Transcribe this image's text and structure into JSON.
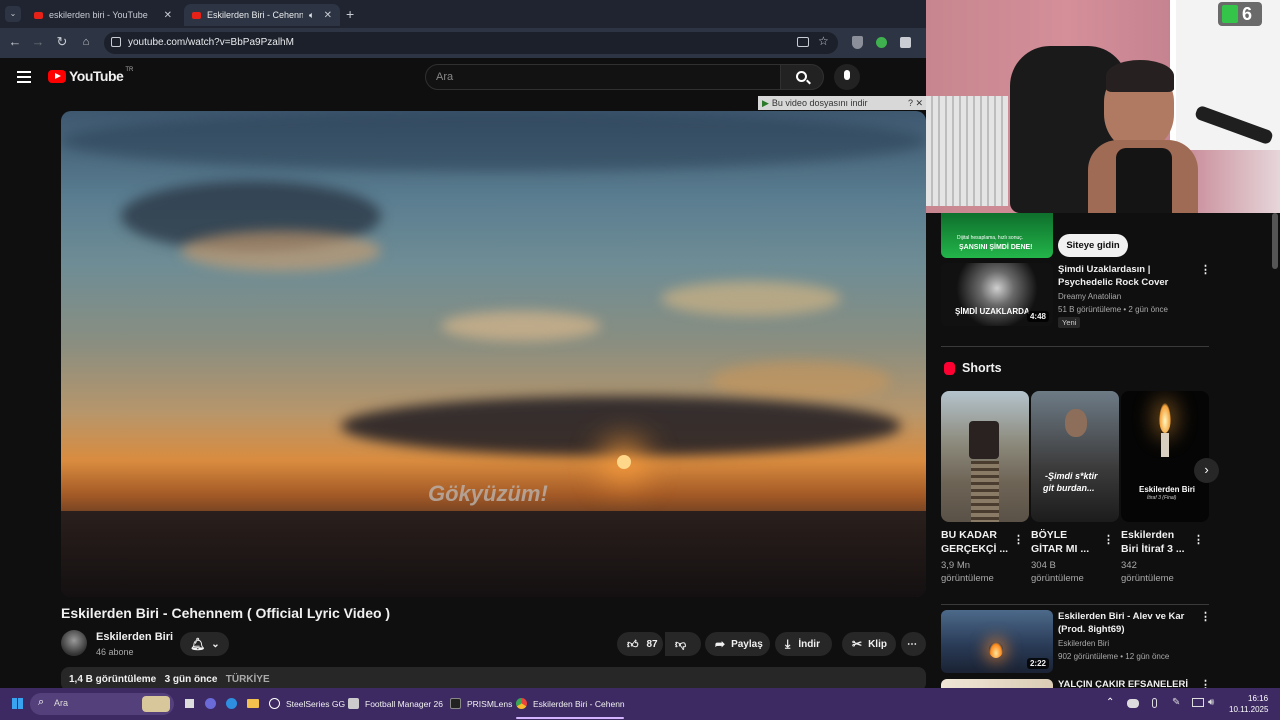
{
  "browser": {
    "tabs": [
      {
        "label": "eskilerden biri - YouTube"
      },
      {
        "label": "Eskilerden Biri - Cehennem"
      }
    ],
    "url": "youtube.com/watch?v=BbPa9PzalhM",
    "download_bar": "Bu video dosyasını indir"
  },
  "header": {
    "logo": "YouTube",
    "region": "TR",
    "search_placeholder": "Ara"
  },
  "video": {
    "lyric": "Gökyüzüm!",
    "title": "Eskilerden Biri - Cehennem ( Official Lyric Video )",
    "channel": "Eskilerden Biri",
    "subscribers": "46 abone",
    "likes": "87",
    "share": "Paylaş",
    "download": "İndir",
    "clip": "Klip",
    "views": "1,4 B görüntüleme",
    "age": "3 gün önce",
    "location": "TÜRKİYE"
  },
  "webcam": {
    "badge": "6"
  },
  "sidebar": {
    "ad": {
      "line1": "Dijital hesaplama, hızlı sonuç.",
      "line2": "ŞANSINI ŞİMDİ DENE!",
      "button": "Siteye gidin"
    },
    "rec1": {
      "title1": "Şimdi Uzaklardasın |",
      "title2": "Psychedelic Rock Cover",
      "channel": "Dreamy Anatolian",
      "meta": "51 B görüntüleme • 2 gün önce",
      "badge": "Yeni",
      "duration": "4:48",
      "thumb_text": "ŞİMDİ UZAKLARDA"
    },
    "shorts_title": "Shorts",
    "shorts": [
      {
        "t1": "BU KADAR",
        "t2": "GERÇEKÇİ ...",
        "v1": "3,9 Mn",
        "v2": "görüntüleme"
      },
      {
        "t1": "BÖYLE",
        "t2": "GİTAR MI ...",
        "v1": "304 B",
        "v2": "görüntüleme",
        "overlay1": "-Şimdi s*ktir",
        "overlay2": "git burdan..."
      },
      {
        "t1": "Eskilerden",
        "t2": "Biri İtiraf 3 ...",
        "v1": "342",
        "v2": "görüntüleme",
        "overlay1": "Eskilerden Biri",
        "overlay2": "İtiraf 3 (Final)"
      }
    ],
    "rec2": {
      "title1": "Eskilerden Biri - Alev ve Kar",
      "title2": "(Prod. 8ight69)",
      "channel": "Eskilerden Biri",
      "meta": "902 görüntüleme • 12 gün önce",
      "duration": "2:22"
    },
    "rec3": {
      "title": "YALÇIN ÇAKIR EFSANELERİ"
    }
  },
  "taskbar": {
    "search": "Ara",
    "apps": [
      "SteelSeries GG",
      "Football Manager 26",
      "PRISMLens",
      "Eskilerden Biri - Cehenn"
    ],
    "time": "16:16",
    "date": "10.11.2025"
  }
}
